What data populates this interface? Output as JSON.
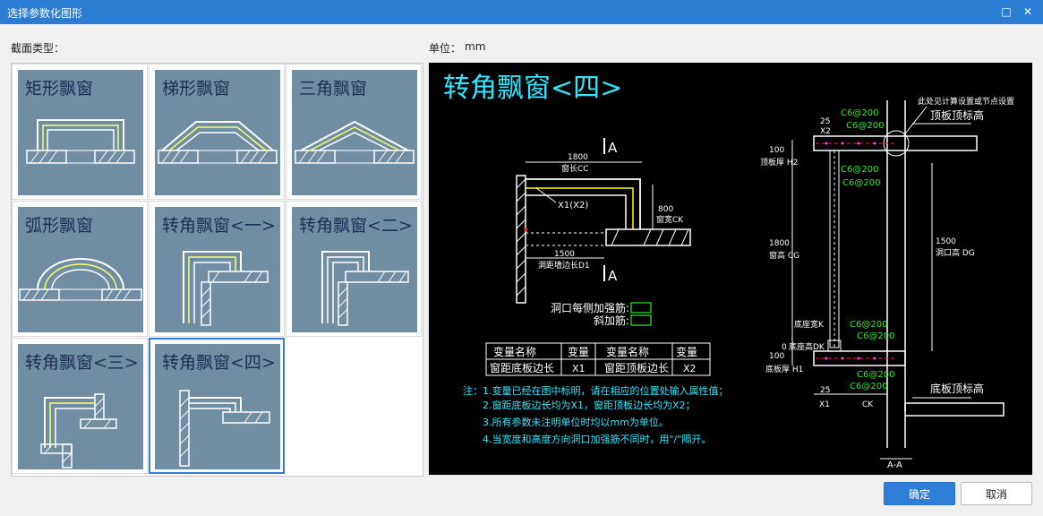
{
  "window": {
    "title": "选择参数化图形"
  },
  "section_label": "截面类型：",
  "unit": {
    "label": "单位：",
    "value": "mm"
  },
  "thumbnails": [
    {
      "label": "矩形飘窗"
    },
    {
      "label": "梯形飘窗"
    },
    {
      "label": "三角飘窗"
    },
    {
      "label": "弧形飘窗"
    },
    {
      "label": "转角飘窗<一>"
    },
    {
      "label": "转角飘窗<二>"
    },
    {
      "label": "转角飘窗<三>"
    },
    {
      "label": "转角飘窗<四>"
    }
  ],
  "preview": {
    "title": "转角飘窗<四>",
    "section_mark": "A",
    "dims": {
      "d1800": "1800",
      "window_length": "窗长CC",
      "x1x2": "X1(X2)",
      "d800": "800",
      "window_width": "窗宽CK",
      "d1500": "1500",
      "wall_dist": "洞距墙边长D1"
    },
    "rebar": {
      "opening": "洞口每侧加强筋:",
      "diagonal": "斜加筋:"
    },
    "table": {
      "headers": [
        "变量名称",
        "变量",
        "变量名称",
        "变量"
      ],
      "row": [
        "窗距底板边长",
        "X1",
        "窗距顶板边长",
        "X2"
      ]
    },
    "notes": [
      "注：1.变量已经在图中标明，请在相应的位置处输入属性值；",
      "2.窗距底板边长均为X1，窗距顶板边长均为X2；",
      "3.所有参数未注明单位时均以mm为单位。",
      "4.当宽度和高度方向洞口加强筋不同时，用\"/\"隔开。"
    ],
    "section": {
      "note_top": "此处见计算设置或节点设置",
      "top_label": "顶板顶标高",
      "bottom_label": "底板顶标高",
      "rebar_c6": "C6@200",
      "d25": "25",
      "x2": "X2",
      "x1": "X1",
      "ck": "CK",
      "d100": "100",
      "top_thick": "顶板厚 H2",
      "d1800": "1800",
      "window_height": "窗高 CG",
      "d1500": "1500",
      "opening_height": "洞口高 DG",
      "bottom_width": "底座宽K",
      "bottom_height": "底座高DK",
      "d0": "0",
      "bottom_thick": "底板厚 H1",
      "section_name": "A-A"
    }
  },
  "buttons": {
    "ok": "确定",
    "cancel": "取消"
  }
}
